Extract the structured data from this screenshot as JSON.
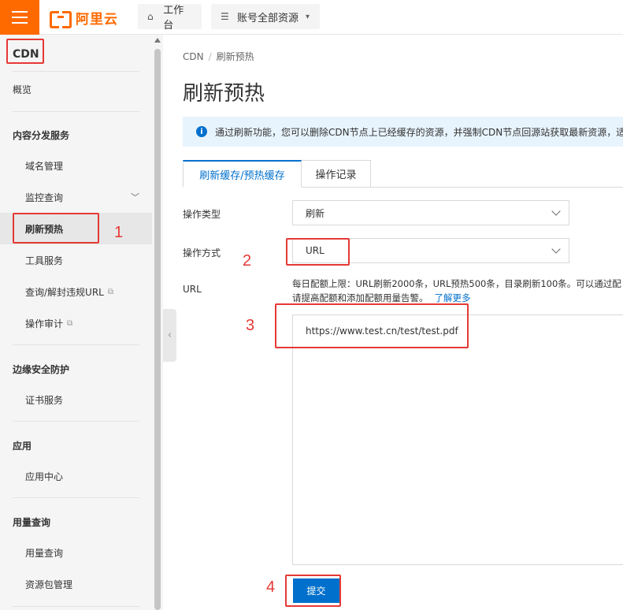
{
  "topbar": {
    "logo_text": "阿里云",
    "workbench": "工作台",
    "resources": "账号全部资源"
  },
  "sidebar": {
    "product": "CDN",
    "overview": "概览",
    "groups": [
      {
        "title": "内容分发服务",
        "items": [
          "域名管理",
          "监控查询",
          "刷新预热",
          "工具服务",
          "查询/解封违规URL",
          "操作审计"
        ]
      },
      {
        "title": "边缘安全防护",
        "items": [
          "证书服务"
        ]
      },
      {
        "title": "应用",
        "items": [
          "应用中心"
        ]
      },
      {
        "title": "用量查询",
        "items": [
          "用量查询",
          "资源包管理"
        ]
      }
    ],
    "active": "刷新预热"
  },
  "main": {
    "breadcrumb": [
      "CDN",
      "刷新预热"
    ],
    "title": "刷新预热",
    "notice": "通过刷新功能，您可以删除CDN节点上已经缓存的资源，并强制CDN节点回源站获取最新资源，适",
    "tabs": [
      "刷新缓存/预热缓存",
      "操作记录"
    ],
    "form": {
      "op_type_label": "操作类型",
      "op_type_value": "刷新",
      "op_mode_label": "操作方式",
      "op_mode_value": "URL",
      "url_label": "URL",
      "help_line1": "每日配额上限：URL刷新2000条，URL预热500条，目录刷新100条。可以通过配",
      "help_line2": "请提高配额和添加配额用量告警。",
      "help_link": "了解更多",
      "url_value": "https://www.test.cn/test/test.pdf",
      "submit": "提交"
    }
  },
  "annotations": [
    "1",
    "2",
    "3",
    "4"
  ],
  "colors": {
    "brand": "#ff6a00",
    "primary": "#0070cc",
    "annotation": "#e53935"
  }
}
